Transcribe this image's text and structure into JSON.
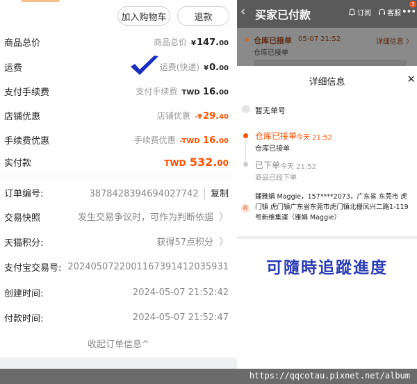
{
  "left": {
    "buttons": {
      "add_cart": "加入购物车",
      "refund": "退款"
    },
    "fees": [
      {
        "label": "商品总价",
        "sub": "商品总价",
        "cur": "¥",
        "amount": "147.",
        "dec": "00"
      },
      {
        "label": "运费",
        "sub": "运费(快递)",
        "cur": "¥",
        "amount": "0.",
        "dec": "00"
      },
      {
        "label": "支付手续费",
        "sub": "支付手续费",
        "cur": "TWD ",
        "amount": "16.",
        "dec": "00"
      },
      {
        "label": "店铺优惠",
        "sub": "店铺优惠",
        "cur": "-¥",
        "amount": "29.",
        "dec": "40"
      },
      {
        "label": "手续费优惠",
        "sub": "手续费优惠",
        "cur": "-TWD ",
        "amount": "16.",
        "dec": "00"
      }
    ],
    "paid": {
      "label": "实付款",
      "cur": "TWD ",
      "amount": "532.",
      "dec": "00"
    },
    "order_no": {
      "label": "订单编号:",
      "value": "3878428394694027742",
      "sep": "|",
      "copy": "复制"
    },
    "snapshot": {
      "label": "交易快照",
      "value": "发生交易争议时，可作为判断依据"
    },
    "points": {
      "label": "天猫积分:",
      "value": "获得57点积分"
    },
    "alipay": {
      "label": "支付宝交易号:",
      "value": "2024050722001167391412035931"
    },
    "created": {
      "label": "创建时间:",
      "value": "2024-05-07 21:52:42"
    },
    "paid_time": {
      "label": "付款时间:",
      "value": "2024-05-07 21:52:47"
    },
    "collapse": "收起订单信息",
    "collapse_arrow": "^"
  },
  "right": {
    "header": {
      "title": "买家已付款",
      "subscribe": "订阅",
      "service": "客服",
      "more": "•••",
      "badge": "3"
    },
    "dim_banner": {
      "title": "仓库已接单",
      "time": "05-07 21:52",
      "link": "详细信息 〉",
      "sub": "仓库已接单"
    },
    "sheet": {
      "title": "详细信息",
      "close": "✕",
      "no_tracking": "暂无单号",
      "step1": {
        "title": "仓库已接单",
        "time": "今天 21:52",
        "sub": "仓库已接单"
      },
      "step2": {
        "title": "已下单",
        "time": "今天 21:52",
        "sub": "商品已经下单"
      },
      "addr_tag": "收",
      "address": "鍾雅娟 Maggie，157****2073，广东省 东莞市 虎门镇 虎门镇广东省东莞市虎门镇北栅凤兴二路1-119号新维集運（雅娟 Maggie）"
    },
    "slogan": "可隨時追蹤進度"
  },
  "watermark": "https://qqcotau.pixnet.net/album",
  "colors": {
    "accent": "#ff5000",
    "slogan": "#2a3bb5",
    "check": "#1a2ec0"
  }
}
